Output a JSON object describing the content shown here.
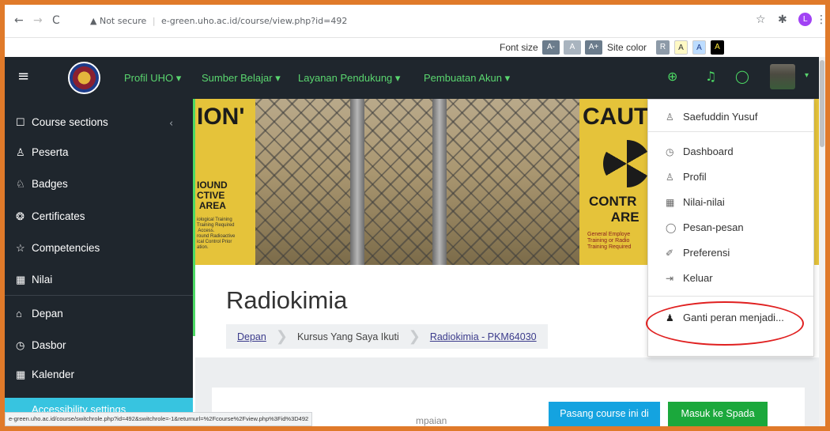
{
  "browser": {
    "back_icon": "←",
    "forward_icon": "→",
    "reload_icon": "C",
    "security_icon": "▲",
    "security_label": "Not secure",
    "url": "e-green.uho.ac.id/course/view.php?id=492",
    "bookmark_icon": "☆",
    "extensions_icon": "✱",
    "profile_initial": "L",
    "menu_icon": "⋮"
  },
  "a11y": {
    "font_size_label": "Font size",
    "font_minus": "A-",
    "font_reset": "A",
    "font_plus": "A+",
    "site_color_label": "Site color",
    "color_r": "R",
    "color_a1": "A",
    "color_a2": "A",
    "color_a3": "A"
  },
  "navbar": {
    "hamburger_icon": "≡",
    "menu": [
      {
        "label": "Profil UHO ▾"
      },
      {
        "label": "Sumber Belajar ▾"
      },
      {
        "label": "Layanan Pendukung ▾"
      },
      {
        "label": "Pembuatan Akun ▾"
      }
    ],
    "globe_icon": "⊕",
    "bell_icon": "♫",
    "message_icon": "◯",
    "user_caret": "▾"
  },
  "sidebar": {
    "items": [
      {
        "label": "Course sections",
        "icon": "☐"
      },
      {
        "label": "Peserta",
        "icon": "♙"
      },
      {
        "label": "Badges",
        "icon": "♘"
      },
      {
        "label": "Certificates",
        "icon": "❂"
      },
      {
        "label": "Competencies",
        "icon": "☆"
      },
      {
        "label": "Nilai",
        "icon": "▦"
      },
      {
        "label": "Depan",
        "icon": "⌂"
      },
      {
        "label": "Dasbor",
        "icon": "◷"
      },
      {
        "label": "Kalender",
        "icon": "▦"
      }
    ],
    "collapse_icon": "‹",
    "a11y_button": "Accessibility settings"
  },
  "hero": {
    "left_big": "ION'",
    "left_mid": "IOUND\nCTIVE\n AREA",
    "left_small": "iological Training\nTraining Required\n Access.\nround Radioactive\nical Control Prior\nation.",
    "right_big": "CAUT",
    "right_mid": "CONTR\n      ARE",
    "right_small": "General Employe\nTraining or Radio\nTraining Required"
  },
  "course": {
    "title": "Radiokimia",
    "breadcrumb": [
      {
        "label": "Depan",
        "link": true
      },
      {
        "label": "Kursus Yang Saya Ikuti",
        "link": false
      },
      {
        "label": "Radiokimia - PKM64030",
        "link": true
      }
    ],
    "breadcrumb_sep": "❯"
  },
  "actions": {
    "pasang": "Pasang course ini di Spada",
    "masuk": "Masuk ke Spada",
    "behind_text": "mpaian"
  },
  "statusbar": {
    "text": "e-green.uho.ac.id/course/switchrole.php?id=492&switchrole=-1&returnurl=%2Fcourse%2Fview.php%3Fid%3D492"
  },
  "user_menu": {
    "name": "Saefuddin Yusuf",
    "name_icon": "♙",
    "items": [
      {
        "label": "Dashboard",
        "icon": "◷"
      },
      {
        "label": "Profil",
        "icon": "♙"
      },
      {
        "label": "Nilai-nilai",
        "icon": "▦"
      },
      {
        "label": "Pesan-pesan",
        "icon": "◯"
      },
      {
        "label": "Preferensi",
        "icon": "✐"
      },
      {
        "label": "Keluar",
        "icon": "⇥"
      }
    ],
    "switch_role": "Ganti peran menjadi...",
    "switch_role_icon": "♟"
  }
}
